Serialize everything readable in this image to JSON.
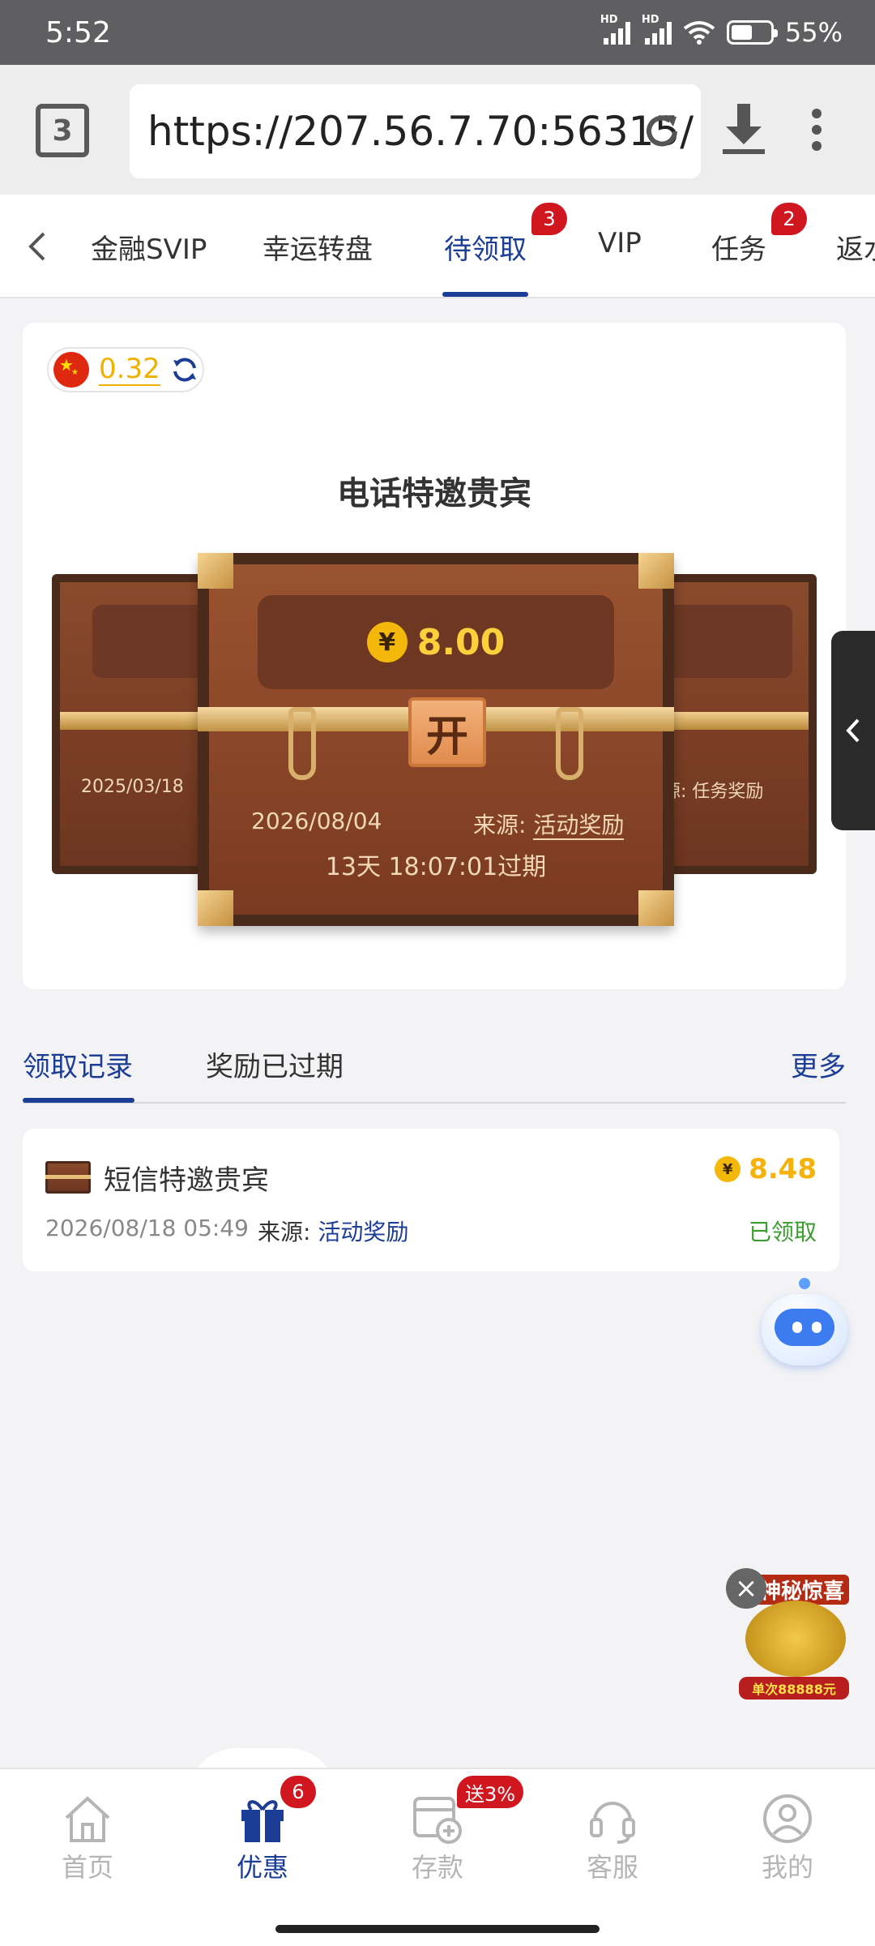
{
  "status_bar": {
    "time": "5:52",
    "battery": "55%",
    "signal_tag": "HD"
  },
  "browser": {
    "tab_count": "3",
    "url": "https://207.56.7.70:56315/"
  },
  "tabs": [
    {
      "label": "金融SVIP"
    },
    {
      "label": "幸运转盘"
    },
    {
      "label": "待领取",
      "badge": "3"
    },
    {
      "label": "VIP"
    },
    {
      "label": "任务",
      "badge": "2"
    },
    {
      "label": "返水"
    }
  ],
  "balance": {
    "amount": "0.32"
  },
  "card": {
    "title": "电话特邀贵宾",
    "chest": {
      "coin_symbol": "¥",
      "amount": "8.00",
      "lock_char": "开",
      "date": "2026/08/04",
      "source_label": "来源:",
      "source_value": "活动奖励",
      "expiry": "13天 18:07:01过期"
    },
    "left_chest_date": "2025/03/18",
    "right_chest_source": "源: 任务奖励"
  },
  "records": {
    "tabs": [
      "领取记录",
      "奖励已过期"
    ],
    "more": "更多",
    "items": [
      {
        "title": "短信特邀贵宾",
        "amount": "8.48",
        "date": "2026/08/18 05:49",
        "source_label": "来源:",
        "source_value": "活动奖励",
        "status": "已领取"
      }
    ]
  },
  "promo": {
    "title": "神秘惊喜",
    "footer": "单次88888元"
  },
  "bottom_nav": [
    {
      "label": "首页"
    },
    {
      "label": "优惠",
      "badge": "6"
    },
    {
      "label": "存款",
      "badge": "送3%"
    },
    {
      "label": "客服"
    },
    {
      "label": "我的"
    }
  ],
  "colors": {
    "accent": "#1c3d96",
    "gold": "#f4b20b",
    "badge_red": "#d0161f",
    "claimed_green": "#3a9d2f"
  }
}
